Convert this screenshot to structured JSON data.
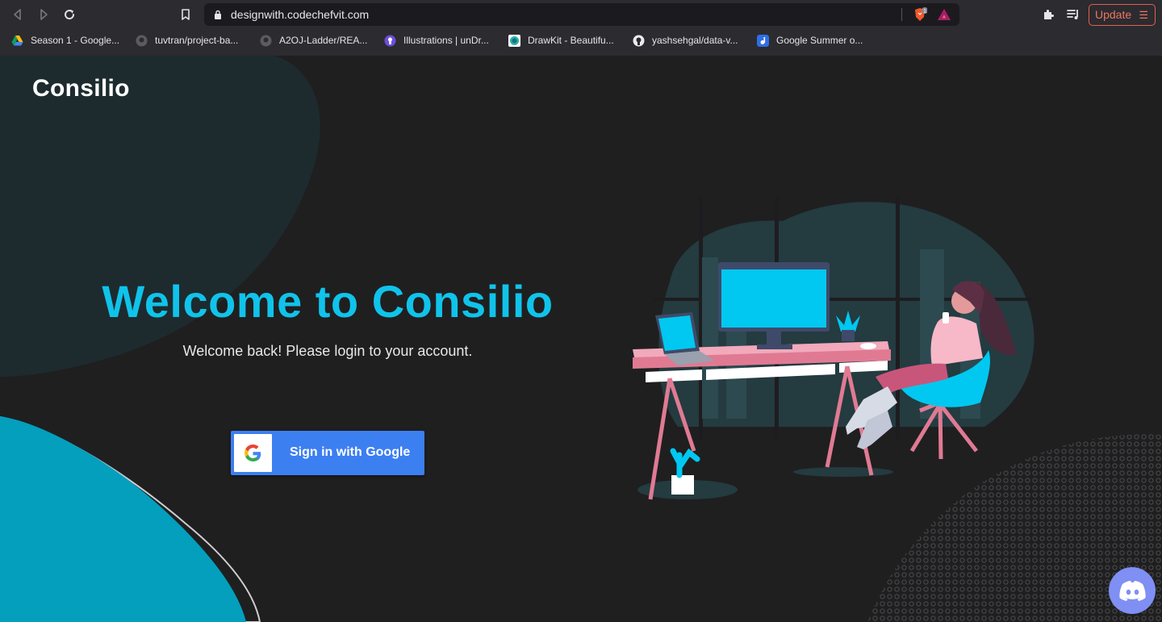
{
  "browser": {
    "url": "designwith.codechefvit.com",
    "shield_count": "1",
    "update_label": "Update",
    "bookmarks": [
      {
        "label": "Season 1 - Google...",
        "icon": "google-drive-icon"
      },
      {
        "label": "tuvtran/project-ba...",
        "icon": "github-icon"
      },
      {
        "label": "A2OJ-Ladder/REA...",
        "icon": "github-icon"
      },
      {
        "label": "Illustrations | unDr...",
        "icon": "undraw-icon"
      },
      {
        "label": "DrawKit - Beautifu...",
        "icon": "drawkit-icon"
      },
      {
        "label": "yashsehgal/data-v...",
        "icon": "github-icon"
      },
      {
        "label": "Google Summer o...",
        "icon": "gsoc-icon"
      }
    ]
  },
  "page": {
    "logo": "Consilio",
    "title": "Welcome to Consilio",
    "subtitle": "Welcome back! Please login to your account.",
    "google_button_label": "Sign in with Google"
  },
  "colors": {
    "accent": "#10c3ea",
    "google_blue": "#3c7ff1",
    "update_red": "#ee7462",
    "discord": "#7f8ff4"
  }
}
